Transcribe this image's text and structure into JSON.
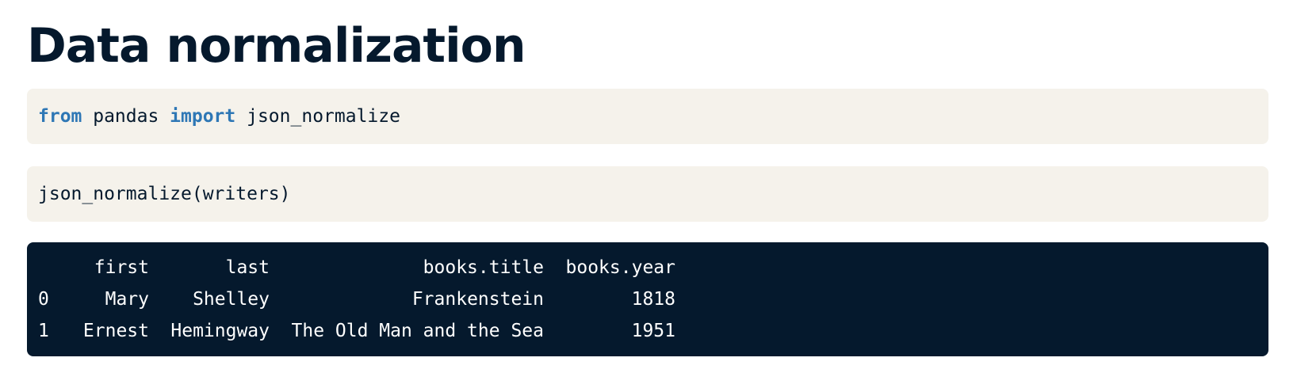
{
  "page": {
    "title": "Data normalization"
  },
  "cells": [
    {
      "tokens": [
        {
          "text": "from",
          "keyword": true
        },
        {
          "text": " pandas ",
          "keyword": false
        },
        {
          "text": "import",
          "keyword": true
        },
        {
          "text": " json_normalize",
          "keyword": false
        }
      ]
    },
    {
      "tokens": [
        {
          "text": "json_normalize(writers)",
          "keyword": false
        }
      ]
    }
  ],
  "output": {
    "columns": [
      "first",
      "last",
      "books.title",
      "books.year"
    ],
    "rows": [
      {
        "index": "0",
        "first": "Mary",
        "last": "Shelley",
        "books_title": "Frankenstein",
        "books_year": "1818"
      },
      {
        "index": "1",
        "first": "Ernest",
        "last": "Hemingway",
        "books_title": "The Old Man and the Sea",
        "books_year": "1951"
      }
    ]
  },
  "colors": {
    "title": "#05192d",
    "code_bg": "#f5f2eb",
    "keyword": "#2e77b5",
    "output_bg": "#05192d",
    "output_text": "#ffffff"
  }
}
